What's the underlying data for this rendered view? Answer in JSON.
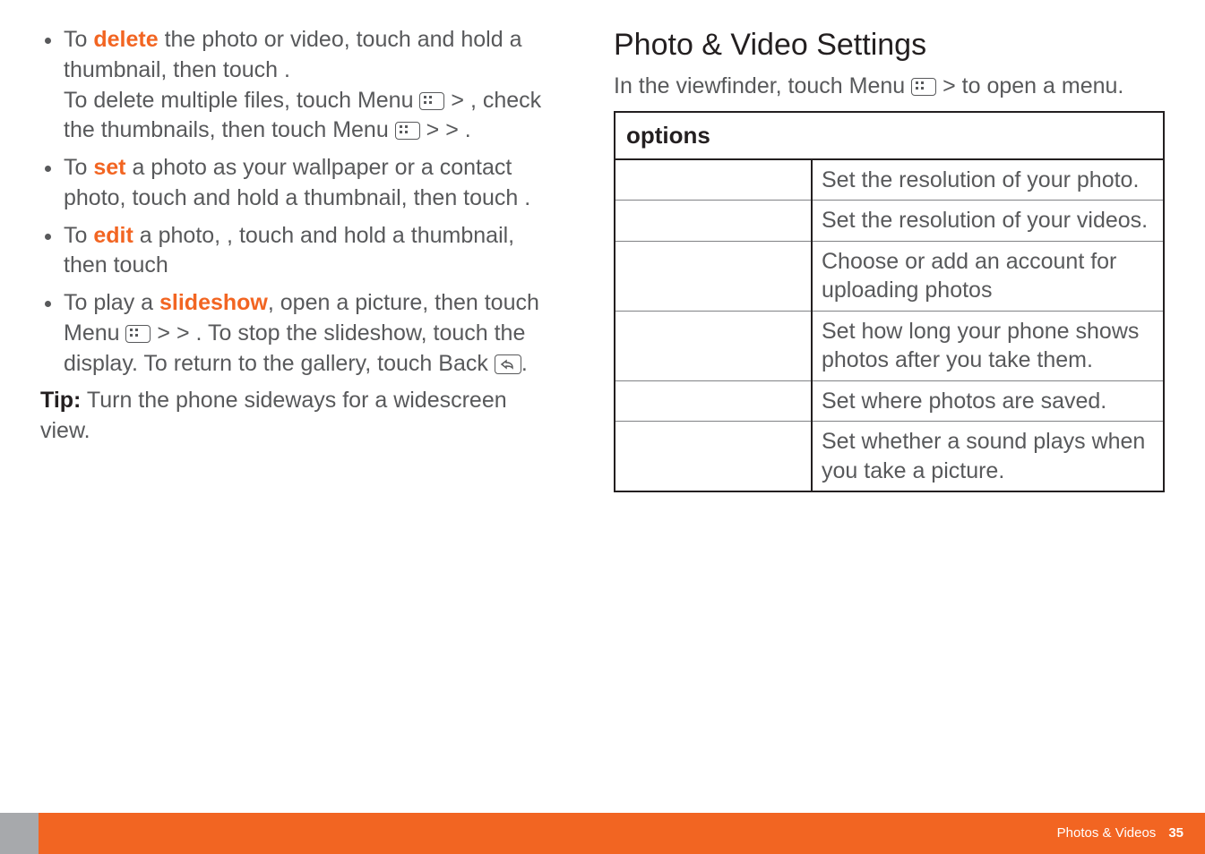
{
  "left": {
    "b1_pre": "To ",
    "b1_kw": "delete",
    "b1_post": " the photo or video, touch and hold a thumbnail, then touch ",
    "b1_end": ".",
    "b1_line2a": "To delete multiple files, touch Menu ",
    "b1_line2b": " > ",
    "b1_line2c": ", check the thumbnails, then touch Menu ",
    "b1_line2d": " > ",
    "b1_line2e": " > ",
    "b1_line2f": ".",
    "b2_pre": "To ",
    "b2_kw": "set",
    "b2_post": " a photo as your wallpaper or a contact photo, touch and hold a thumbnail, then touch ",
    "b2_end": ".",
    "b3_pre": "To ",
    "b3_kw": "edit",
    "b3_post": " a photo, , touch and hold a thumbnail, then touch ",
    "b4_pre": "To play a ",
    "b4_kw": "slideshow",
    "b4_post": ", open a picture, then touch Menu ",
    "b4_mid1": " > ",
    "b4_mid2": " > ",
    "b4_mid3": ". To stop the slideshow, touch the display. To return to the gallery, touch Back ",
    "b4_end": ".",
    "tip_label": "Tip:",
    "tip_text": " Turn the phone sideways for a widescreen view."
  },
  "right": {
    "title": "Photo & Video Settings",
    "intro_a": "In the viewfinder, touch Menu ",
    "intro_b": " > ",
    "intro_c": " to open a menu.",
    "options_header": "options",
    "rows": [
      {
        "label": "",
        "desc": "Set the resolution of your photo."
      },
      {
        "label": "",
        "desc": "Set the resolution of your videos."
      },
      {
        "label": "",
        "desc": "Choose or add an account for uploading photos"
      },
      {
        "label": "",
        "desc": "Set how long your phone shows photos after you take them."
      },
      {
        "label": "",
        "desc": "Set where photos are saved."
      },
      {
        "label": "",
        "desc": "Set whether a sound plays when you take a picture."
      }
    ]
  },
  "footer": {
    "section": "Photos & Videos",
    "page": "35"
  }
}
